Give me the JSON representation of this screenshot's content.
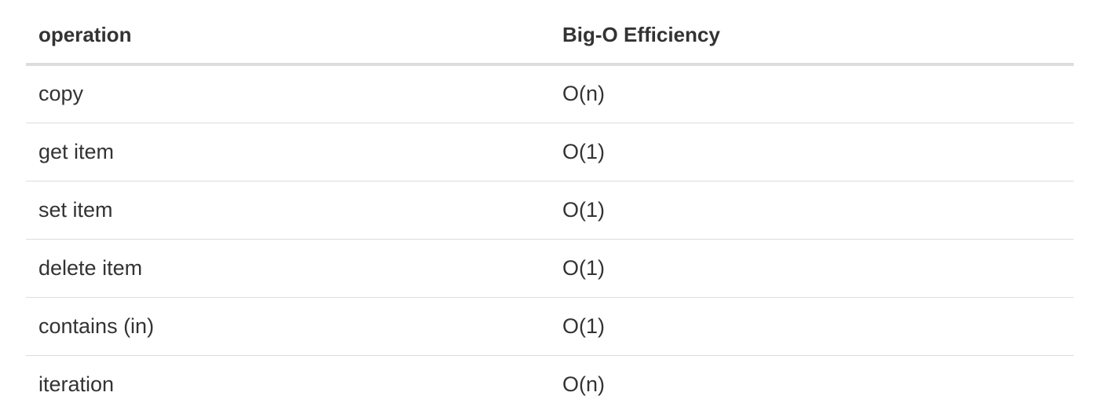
{
  "table": {
    "headers": [
      "operation",
      "Big-O Efficiency"
    ],
    "rows": [
      [
        "copy",
        "O(n)"
      ],
      [
        "get item",
        "O(1)"
      ],
      [
        "set item",
        "O(1)"
      ],
      [
        "delete item",
        "O(1)"
      ],
      [
        "contains (in)",
        "O(1)"
      ],
      [
        "iteration",
        "O(n)"
      ]
    ]
  },
  "colors": {
    "text": "#333333",
    "border": "#dddddd",
    "background": "#ffffff"
  }
}
